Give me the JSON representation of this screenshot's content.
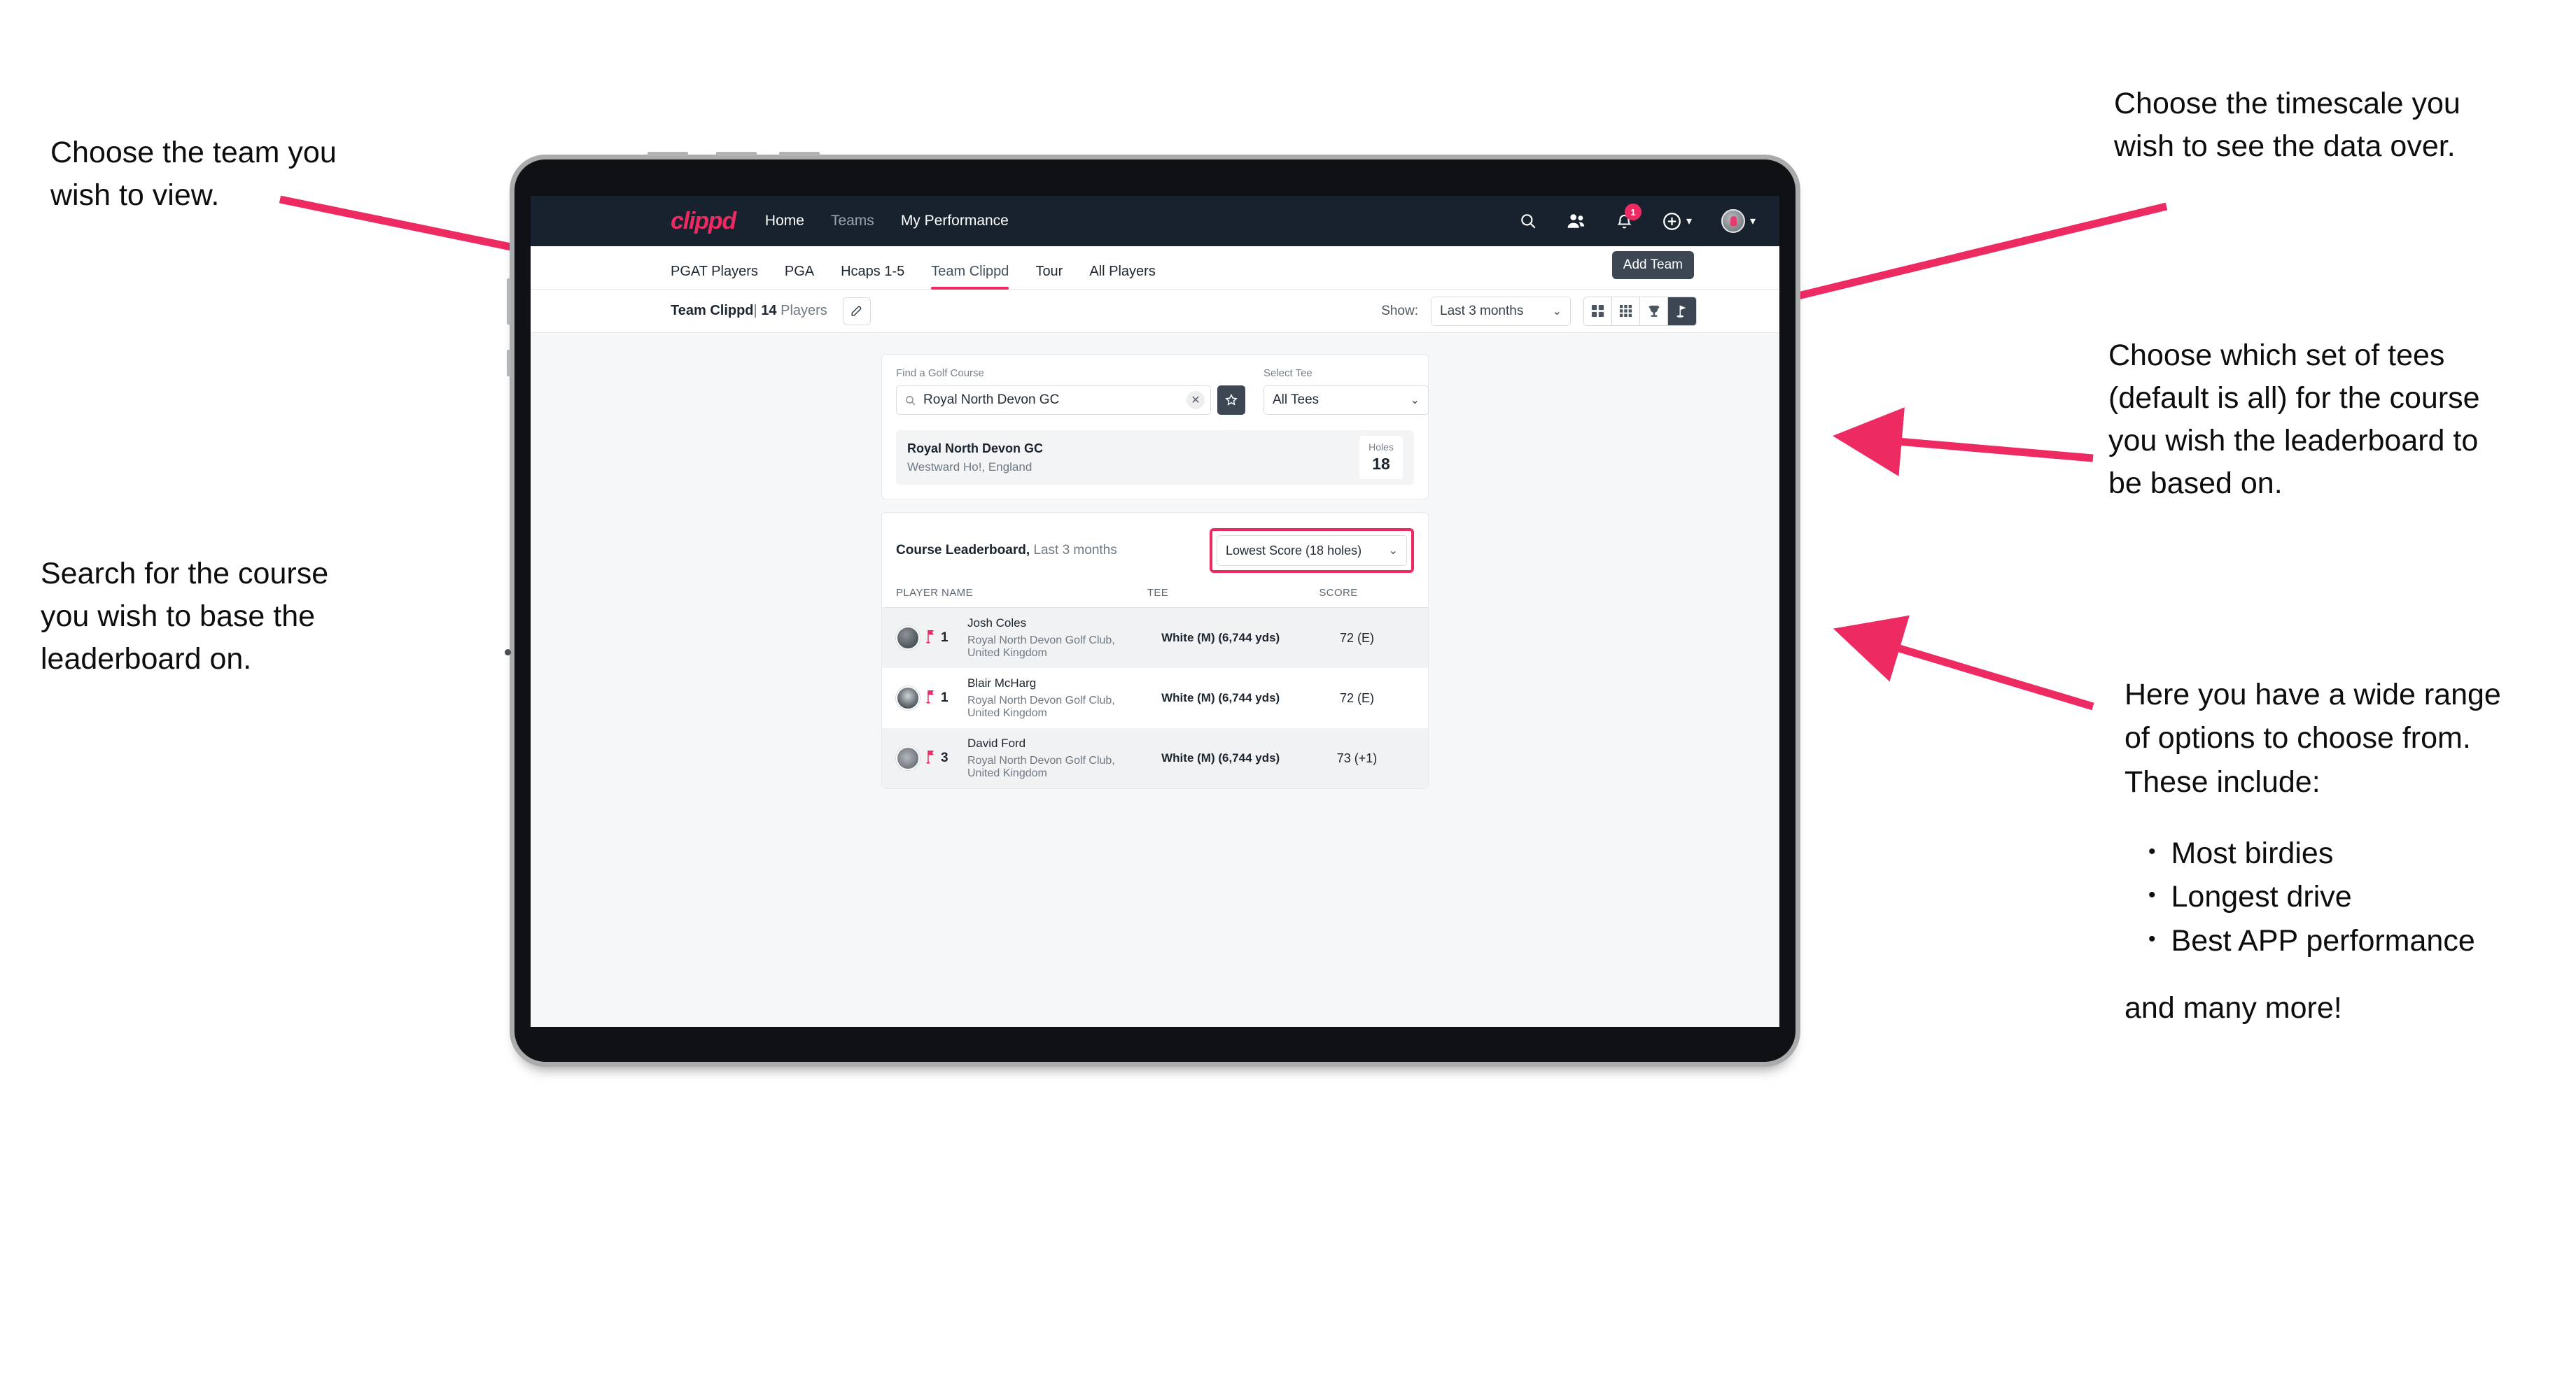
{
  "annotations": {
    "left_top": "Choose the team you\nwish to view.",
    "left_mid": "Search for the course\nyou wish to base the\nleaderboard on.",
    "right_top": "Choose the timescale you\nwish to see the data over.",
    "right_mid": "Choose which set of tees\n(default is all) for the course\nyou wish the leaderboard to\nbe based on.",
    "right_bottom_intro": "Here you have a wide range\nof options to choose from.\nThese include:",
    "right_bottom_items": [
      "Most birdies",
      "Longest drive",
      "Best APP performance"
    ],
    "right_bottom_outro": "and many more!"
  },
  "navbar": {
    "brand": "clippd",
    "links": [
      {
        "label": "Home",
        "active": true
      },
      {
        "label": "Teams",
        "active": false
      },
      {
        "label": "My Performance",
        "active": true
      }
    ],
    "icons": [
      "search-icon",
      "people-icon",
      "bell-icon",
      "plus-circle-icon",
      "avatar-icon"
    ],
    "notification_count": "1"
  },
  "tabs": [
    {
      "label": "PGAT Players",
      "state": "normal"
    },
    {
      "label": "PGA",
      "state": "normal"
    },
    {
      "label": "Hcaps 1-5",
      "state": "normal"
    },
    {
      "label": "Team Clippd",
      "state": "active"
    },
    {
      "label": "Tour",
      "state": "normal"
    },
    {
      "label": "All Players",
      "state": "normal"
    }
  ],
  "tooltip": {
    "label": "Add Team"
  },
  "teambar": {
    "team_name": "Team Clippd",
    "separator": "|",
    "player_count": "14",
    "players_word": "Players",
    "edit_icon": "pencil-icon",
    "show_label": "Show:",
    "timescale_value": "Last 3 months",
    "view_buttons": [
      {
        "name": "grid-large-view",
        "active": false
      },
      {
        "name": "grid-small-view",
        "active": false
      },
      {
        "name": "trophy-view",
        "active": false
      },
      {
        "name": "course-view",
        "active": true
      }
    ]
  },
  "search": {
    "course_label": "Find a Golf Course",
    "course_value": "Royal North Devon GC",
    "course_placeholder": "Find a Golf Course",
    "clear_icon": "close-icon",
    "favorite_icon": "star-icon",
    "tee_label": "Select Tee",
    "tee_value": "All Tees"
  },
  "course_result": {
    "name": "Royal North Devon GC",
    "location": "Westward Ho!, England",
    "holes_label": "Holes",
    "holes_value": "18"
  },
  "leaderboard": {
    "title": "Course Leaderboard,",
    "subtitle": "Last 3 months",
    "metric_value": "Lowest Score (18 holes)",
    "columns": [
      "PLAYER NAME",
      "TEE",
      "SCORE"
    ],
    "rows": [
      {
        "rank": "1",
        "name": "Josh Coles",
        "club": "Royal North Devon Golf Club, United Kingdom",
        "tee": "White (M) (6,744 yds)",
        "score": "72 (E)"
      },
      {
        "rank": "1",
        "name": "Blair McHarg",
        "club": "Royal North Devon Golf Club, United Kingdom",
        "tee": "White (M) (6,744 yds)",
        "score": "72 (E)"
      },
      {
        "rank": "3",
        "name": "David Ford",
        "club": "Royal North Devon Golf Club, United Kingdom",
        "tee": "White (M) (6,744 yds)",
        "score": "73 (+1)"
      }
    ]
  },
  "colors": {
    "accent": "#ee2a63",
    "navbar": "#18222e",
    "dark_chip": "#3c4753",
    "page_bg": "#f6f7f9"
  }
}
